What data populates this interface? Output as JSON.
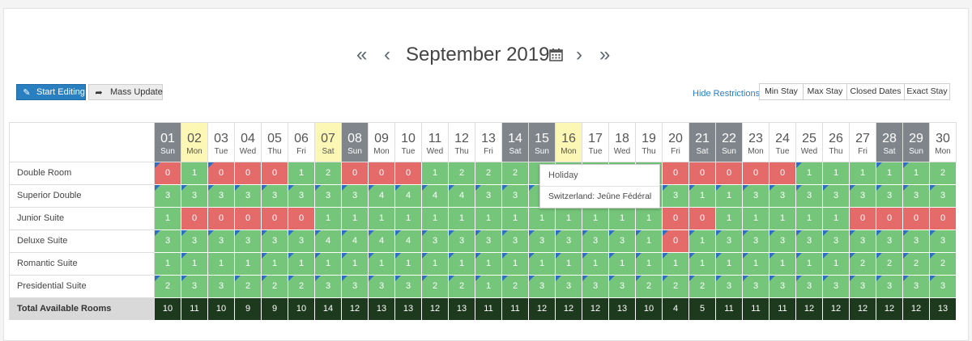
{
  "nav": {
    "first_icon": "double-chevron-left-icon",
    "prev_icon": "chevron-left-icon",
    "title": "September 2019",
    "calendar_icon": "calendar-icon",
    "next_icon": "chevron-right-icon",
    "last_icon": "double-chevron-right-icon"
  },
  "toolbar": {
    "start_editing_label": "Start Editing",
    "start_editing_icon": "pencil-icon",
    "mass_update_label": "Mass Update",
    "mass_update_icon": "share-arrow-icon"
  },
  "restrictions": {
    "hide_label": "Hide Restrictions",
    "buttons": [
      "Min Stay",
      "Max Stay",
      "Closed Dates",
      "Exact Stay"
    ]
  },
  "colors": {
    "available": "#75c57a",
    "unavailable": "#e56a6a",
    "holiday_header": "#fdf7b6",
    "weekend_header": "#7f858b",
    "total_row": "#1e3a1e",
    "accent": "#2a7fc1"
  },
  "days": [
    {
      "num": "01",
      "dow": "Sun",
      "type": "wk"
    },
    {
      "num": "02",
      "dow": "Mon",
      "type": "hol"
    },
    {
      "num": "03",
      "dow": "Tue",
      "type": ""
    },
    {
      "num": "04",
      "dow": "Wed",
      "type": ""
    },
    {
      "num": "05",
      "dow": "Thu",
      "type": ""
    },
    {
      "num": "06",
      "dow": "Fri",
      "type": ""
    },
    {
      "num": "07",
      "dow": "Sat",
      "type": "hol"
    },
    {
      "num": "08",
      "dow": "Sun",
      "type": "wk"
    },
    {
      "num": "09",
      "dow": "Mon",
      "type": ""
    },
    {
      "num": "10",
      "dow": "Tue",
      "type": ""
    },
    {
      "num": "11",
      "dow": "Wed",
      "type": ""
    },
    {
      "num": "12",
      "dow": "Thu",
      "type": ""
    },
    {
      "num": "13",
      "dow": "Fri",
      "type": ""
    },
    {
      "num": "14",
      "dow": "Sat",
      "type": "wk"
    },
    {
      "num": "15",
      "dow": "Sun",
      "type": "wk"
    },
    {
      "num": "16",
      "dow": "Mon",
      "type": "hol"
    },
    {
      "num": "17",
      "dow": "Tue",
      "type": ""
    },
    {
      "num": "18",
      "dow": "Wed",
      "type": ""
    },
    {
      "num": "19",
      "dow": "Thu",
      "type": ""
    },
    {
      "num": "20",
      "dow": "Fri",
      "type": ""
    },
    {
      "num": "21",
      "dow": "Sat",
      "type": "wk"
    },
    {
      "num": "22",
      "dow": "Sun",
      "type": "wk"
    },
    {
      "num": "23",
      "dow": "Mon",
      "type": ""
    },
    {
      "num": "24",
      "dow": "Tue",
      "type": ""
    },
    {
      "num": "25",
      "dow": "Wed",
      "type": ""
    },
    {
      "num": "26",
      "dow": "Thu",
      "type": ""
    },
    {
      "num": "27",
      "dow": "Fri",
      "type": ""
    },
    {
      "num": "28",
      "dow": "Sat",
      "type": "wk"
    },
    {
      "num": "29",
      "dow": "Sun",
      "type": "wk"
    },
    {
      "num": "30",
      "dow": "Mon",
      "type": ""
    }
  ],
  "rooms": [
    {
      "name": "Double Room",
      "values": [
        0,
        1,
        0,
        0,
        0,
        1,
        2,
        0,
        0,
        0,
        1,
        2,
        2,
        2,
        "",
        "",
        "",
        "",
        "",
        0,
        0,
        0,
        0,
        0,
        1,
        1,
        1,
        1,
        1,
        2
      ],
      "restricted": [
        1,
        0,
        1,
        0,
        0,
        0,
        0,
        0,
        0,
        0,
        0,
        0,
        0,
        0,
        0,
        0,
        0,
        0,
        0,
        0,
        0,
        0,
        0,
        0,
        1,
        0,
        0,
        1,
        1,
        0
      ]
    },
    {
      "name": "Superior Double",
      "values": [
        3,
        3,
        3,
        3,
        3,
        3,
        3,
        3,
        4,
        4,
        4,
        4,
        3,
        3,
        "",
        "",
        "",
        "",
        "",
        3,
        1,
        1,
        3,
        3,
        3,
        3,
        3,
        3,
        3,
        3
      ],
      "restricted": [
        1,
        1,
        1,
        1,
        1,
        1,
        1,
        1,
        1,
        1,
        1,
        1,
        1,
        1,
        1,
        1,
        1,
        1,
        1,
        1,
        1,
        1,
        1,
        1,
        1,
        1,
        1,
        1,
        1,
        1
      ]
    },
    {
      "name": "Junior Suite",
      "values": [
        1,
        0,
        0,
        0,
        0,
        0,
        1,
        1,
        1,
        1,
        1,
        1,
        1,
        1,
        1,
        1,
        1,
        1,
        1,
        0,
        0,
        1,
        1,
        1,
        1,
        1,
        0,
        0,
        0,
        0
      ],
      "restricted": [
        0,
        0,
        0,
        0,
        0,
        0,
        0,
        0,
        0,
        0,
        0,
        0,
        0,
        0,
        0,
        0,
        0,
        0,
        0,
        0,
        0,
        0,
        0,
        0,
        0,
        0,
        0,
        0,
        0,
        0
      ]
    },
    {
      "name": "Deluxe Suite",
      "values": [
        3,
        3,
        3,
        3,
        3,
        3,
        4,
        4,
        4,
        4,
        3,
        3,
        3,
        3,
        3,
        3,
        3,
        3,
        1,
        0,
        1,
        3,
        3,
        3,
        3,
        3,
        3,
        3,
        3,
        3
      ],
      "restricted": [
        1,
        1,
        1,
        1,
        1,
        1,
        1,
        1,
        1,
        1,
        1,
        1,
        1,
        1,
        1,
        1,
        1,
        1,
        1,
        1,
        1,
        1,
        1,
        1,
        1,
        1,
        1,
        1,
        1,
        1
      ]
    },
    {
      "name": "Romantic Suite",
      "values": [
        1,
        1,
        1,
        1,
        1,
        1,
        1,
        1,
        1,
        1,
        1,
        1,
        1,
        1,
        1,
        1,
        1,
        1,
        1,
        1,
        1,
        1,
        1,
        1,
        1,
        1,
        2,
        2,
        2,
        2
      ],
      "restricted": [
        0,
        1,
        0,
        0,
        1,
        1,
        1,
        1,
        1,
        1,
        1,
        1,
        1,
        1,
        1,
        1,
        1,
        1,
        1,
        1,
        1,
        1,
        1,
        1,
        1,
        1,
        1,
        1,
        1,
        1
      ]
    },
    {
      "name": "Presidential Suite",
      "values": [
        2,
        3,
        3,
        2,
        2,
        2,
        3,
        3,
        3,
        3,
        2,
        2,
        1,
        2,
        3,
        3,
        3,
        3,
        2,
        2,
        2,
        3,
        3,
        3,
        3,
        3,
        3,
        3,
        3,
        3
      ],
      "restricted": [
        1,
        1,
        0,
        1,
        1,
        1,
        1,
        1,
        1,
        1,
        1,
        1,
        1,
        1,
        1,
        1,
        1,
        1,
        1,
        1,
        1,
        1,
        1,
        1,
        1,
        1,
        1,
        1,
        1,
        1
      ]
    }
  ],
  "totals": {
    "label": "Total Available Rooms",
    "values": [
      10,
      11,
      10,
      9,
      9,
      10,
      14,
      12,
      13,
      13,
      12,
      13,
      11,
      11,
      12,
      12,
      12,
      13,
      10,
      4,
      5,
      11,
      11,
      11,
      12,
      12,
      12,
      12,
      12,
      13
    ]
  },
  "tooltip": {
    "title": "Holiday",
    "text": "Switzerland: Jeûne Fédéral"
  }
}
